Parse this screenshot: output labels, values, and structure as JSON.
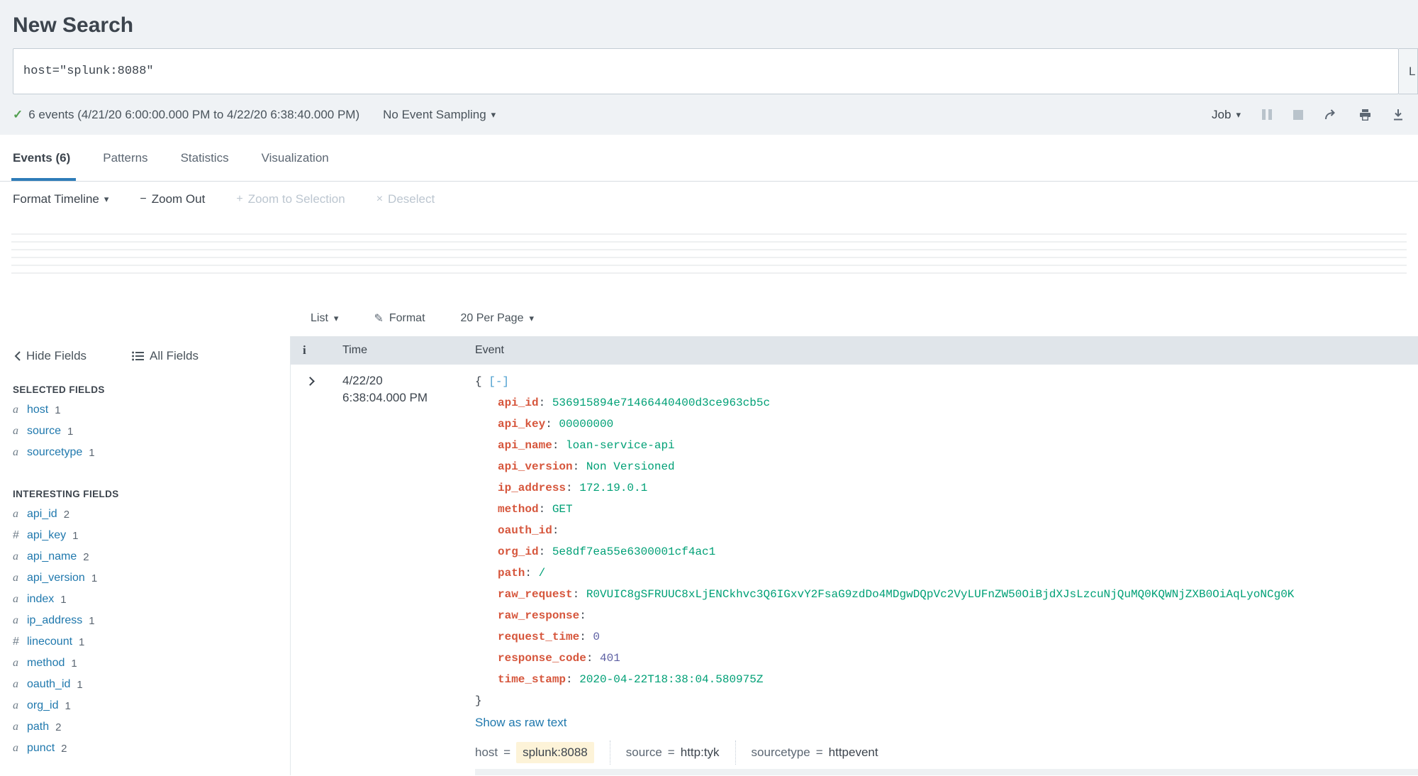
{
  "icons": {
    "check": "✓",
    "caret": "▾",
    "minus": "−",
    "plus": "+",
    "x": "×",
    "brush": "✎",
    "info": "i"
  },
  "header": {
    "title": "New Search",
    "search_query": "host=\"splunk:8088\"",
    "time_picker_partial": "L",
    "status": "6 events (4/21/20 6:00:00.000 PM to 4/22/20 6:38:40.000 PM)",
    "sampling_label": "No Event Sampling",
    "job_label": "Job"
  },
  "tabs": [
    {
      "label": "Events (6)",
      "active": true
    },
    {
      "label": "Patterns",
      "active": false
    },
    {
      "label": "Statistics",
      "active": false
    },
    {
      "label": "Visualization",
      "active": false
    }
  ],
  "timeline": {
    "format_label": "Format Timeline",
    "zoom_out_label": "Zoom Out",
    "zoom_selection_label": "Zoom to Selection",
    "deselect_label": "Deselect"
  },
  "results_toolbar": {
    "list_label": "List",
    "format_label": "Format",
    "per_page_label": "20 Per Page"
  },
  "fields_sidebar": {
    "hide_label": "Hide Fields",
    "all_label": "All Fields",
    "selected_title": "SELECTED FIELDS",
    "selected": [
      {
        "type": "a",
        "name": "host",
        "count": "1"
      },
      {
        "type": "a",
        "name": "source",
        "count": "1"
      },
      {
        "type": "a",
        "name": "sourcetype",
        "count": "1"
      }
    ],
    "interesting_title": "INTERESTING FIELDS",
    "interesting": [
      {
        "type": "a",
        "name": "api_id",
        "count": "2"
      },
      {
        "type": "#",
        "name": "api_key",
        "count": "1"
      },
      {
        "type": "a",
        "name": "api_name",
        "count": "2"
      },
      {
        "type": "a",
        "name": "api_version",
        "count": "1"
      },
      {
        "type": "a",
        "name": "index",
        "count": "1"
      },
      {
        "type": "a",
        "name": "ip_address",
        "count": "1"
      },
      {
        "type": "#",
        "name": "linecount",
        "count": "1"
      },
      {
        "type": "a",
        "name": "method",
        "count": "1"
      },
      {
        "type": "a",
        "name": "oauth_id",
        "count": "1"
      },
      {
        "type": "a",
        "name": "org_id",
        "count": "1"
      },
      {
        "type": "a",
        "name": "path",
        "count": "2"
      },
      {
        "type": "a",
        "name": "punct",
        "count": "2"
      }
    ]
  },
  "event_table": {
    "columns": {
      "info": "i",
      "time": "Time",
      "event": "Event"
    },
    "event": {
      "date": "4/22/20",
      "time": "6:38:04.000 PM",
      "json_open": "{",
      "collapse_toggle": "[-]",
      "json_fields": [
        {
          "key": "api_id",
          "value": "536915894e71466440400d3ce963cb5c",
          "type": "string"
        },
        {
          "key": "api_key",
          "value": "00000000",
          "type": "string"
        },
        {
          "key": "api_name",
          "value": "loan-service-api",
          "type": "string"
        },
        {
          "key": "api_version",
          "value": "Non Versioned",
          "type": "string"
        },
        {
          "key": "ip_address",
          "value": "172.19.0.1",
          "type": "string"
        },
        {
          "key": "method",
          "value": "GET",
          "type": "string"
        },
        {
          "key": "oauth_id",
          "value": "",
          "type": "empty"
        },
        {
          "key": "org_id",
          "value": "5e8df7ea55e6300001cf4ac1",
          "type": "string"
        },
        {
          "key": "path",
          "value": "/",
          "type": "string"
        },
        {
          "key": "raw_request",
          "value": "R0VUIC8gSFRUUC8xLjENCkhvc3Q6IGxvY2FsaG9zdDo4MDgwDQpVc2VyLUFnZW50OiBjdXJsLzcuNjQuMQ0KQWNjZXB0OiAqLyoNCg0K",
          "type": "string"
        },
        {
          "key": "raw_response",
          "value": "",
          "type": "empty"
        },
        {
          "key": "request_time",
          "value": "0",
          "type": "number"
        },
        {
          "key": "response_code",
          "value": "401",
          "type": "number"
        },
        {
          "key": "time_stamp",
          "value": "2020-04-22T18:38:04.580975Z",
          "type": "string"
        }
      ],
      "json_close": "}",
      "raw_link": "Show as raw text",
      "footer_fields": [
        {
          "name": "host",
          "eq": "=",
          "value": "splunk:8088",
          "highlight": true
        },
        {
          "name": "source",
          "eq": "=",
          "value": "http:tyk",
          "highlight": false
        },
        {
          "name": "sourcetype",
          "eq": "=",
          "value": "httpevent",
          "highlight": false
        }
      ]
    }
  },
  "colors": {
    "accent_blue": "#2e7cb8",
    "link_blue": "#1f78ad",
    "success_green": "#53a051",
    "json_key": "#d6563c",
    "json_string": "#00a076",
    "json_number": "#5d60a3",
    "highlight_yellow": "#fdf3d8",
    "table_header_bg": "#e0e5ea",
    "top_bg": "#eff2f5"
  }
}
